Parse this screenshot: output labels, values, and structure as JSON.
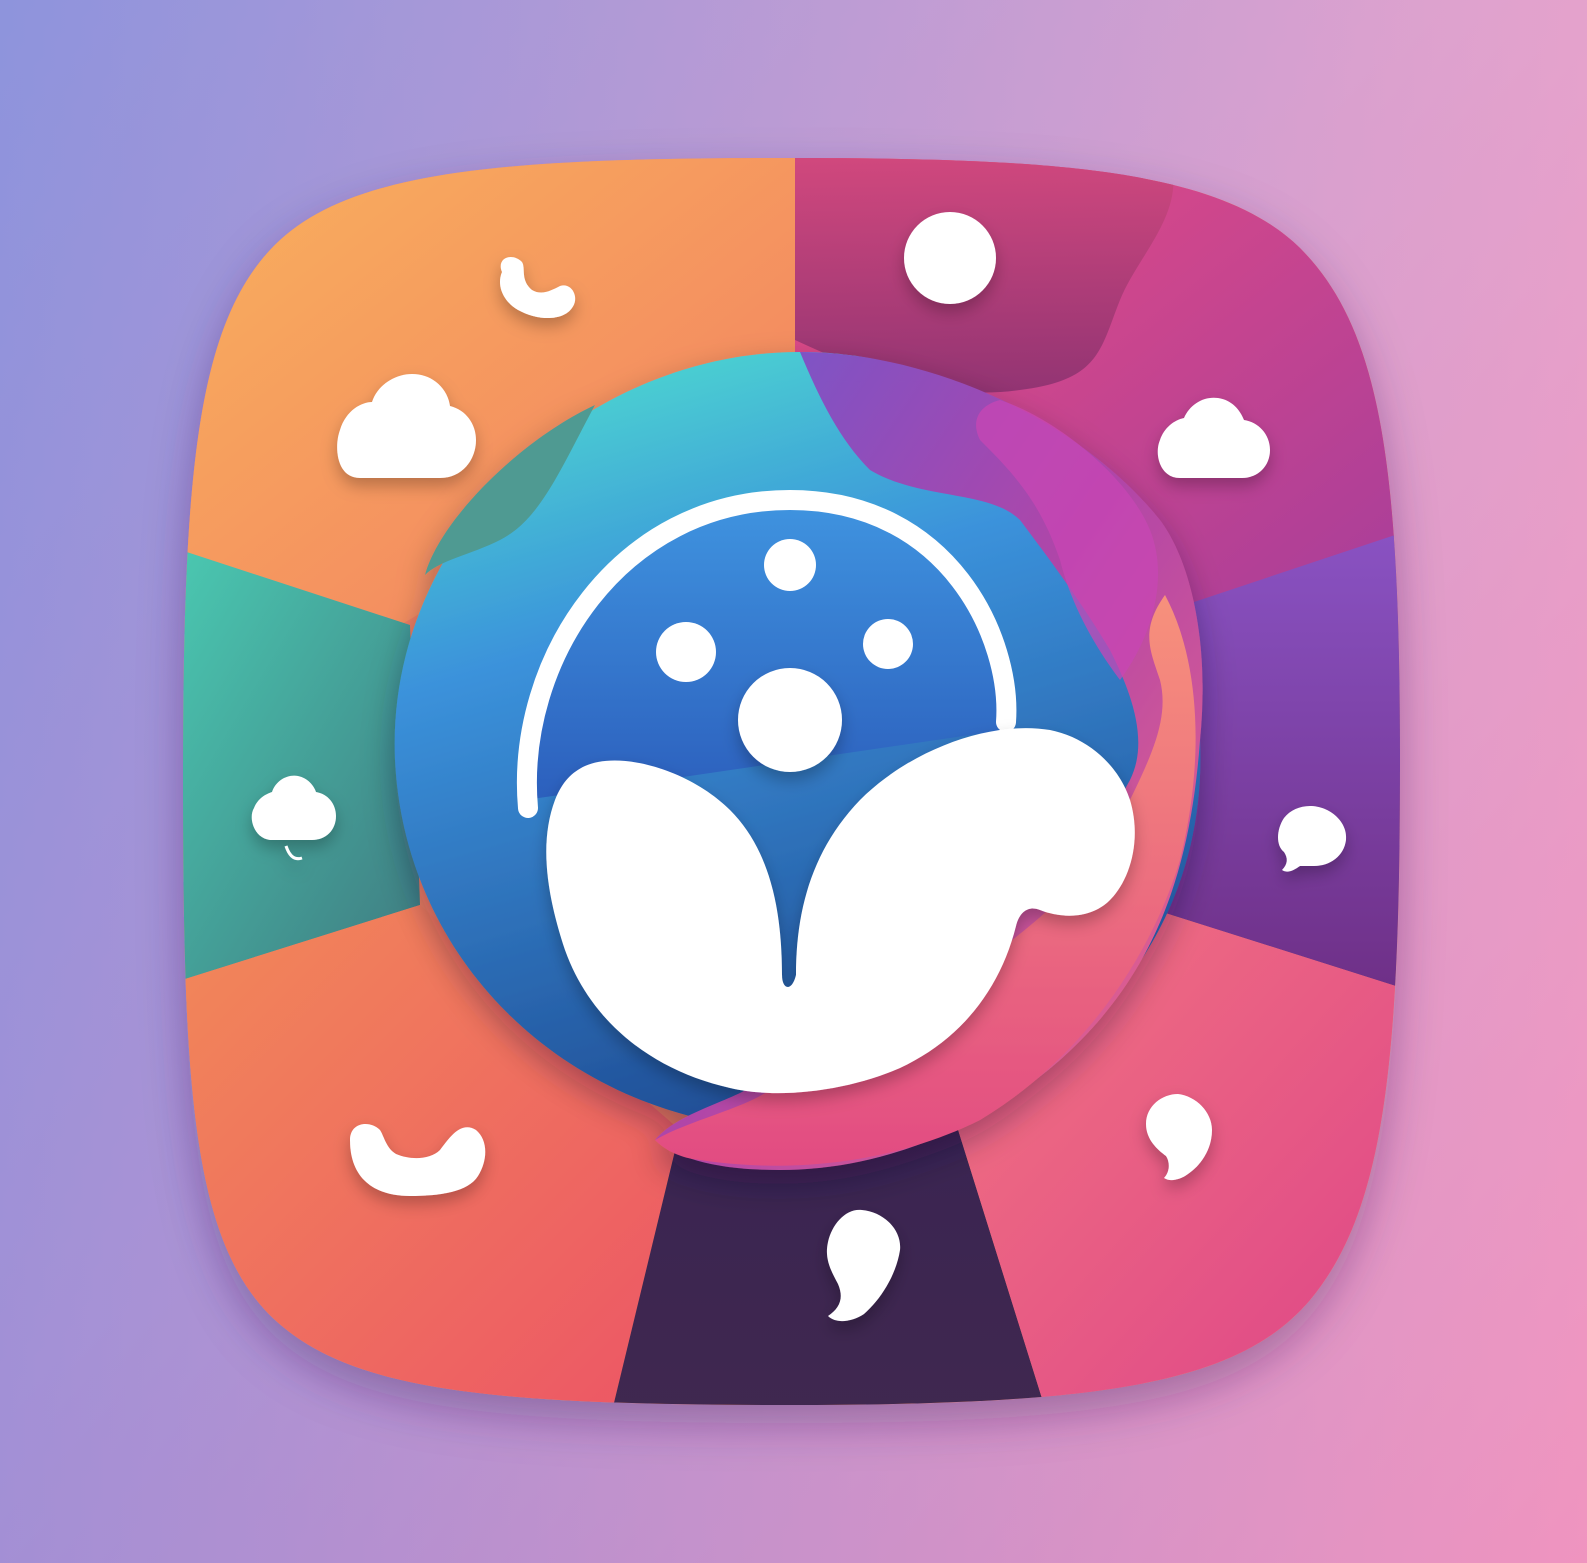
{
  "image": {
    "kind": "app-icon",
    "text_present": false
  },
  "colors": {
    "background_left": "#8fa4e4",
    "background_right": "#f5a2c6",
    "orange_light": "#f8b05c",
    "orange": "#f2875a",
    "coral": "#ec5f63",
    "teal": "#46c7b3",
    "teal_dark": "#3b7a7e",
    "magenta": "#e24a86",
    "plum": "#9a3d83",
    "purple": "#7b3b96",
    "violet": "#6c55c9",
    "eggplant": "#3b2650",
    "pink": "#ee5c8d",
    "cyan": "#4dd6cf",
    "blue": "#3b7fd6",
    "blue_dark": "#1f4d95",
    "white": "#ffffff"
  },
  "icons": [
    "phone-handset-icon",
    "cloud-icon",
    "circle-dot-icon",
    "speech-bubble-icon",
    "user-person-icon",
    "sprout-leaves-icon"
  ]
}
